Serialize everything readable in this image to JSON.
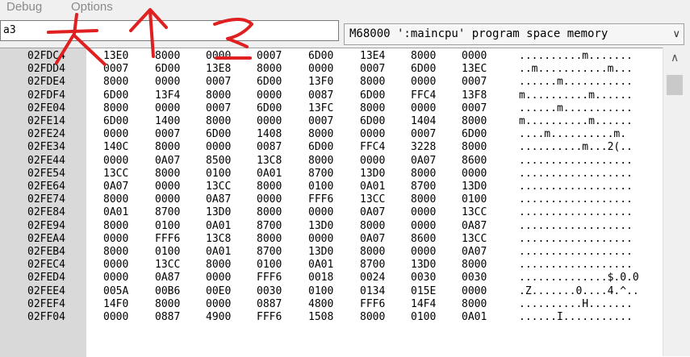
{
  "menu": {
    "debug": "Debug",
    "options": "Options"
  },
  "expression": {
    "value": "a3"
  },
  "space_selector": {
    "value": "M68000 ':maincpu' program space memory",
    "arrow": "∨"
  },
  "scrollbar": {
    "up_arrow": "∧"
  },
  "rows": [
    {
      "addr": "02FDC4",
      "w": [
        "13E0",
        "8000",
        "0000",
        "0007",
        "6D00",
        "13E4",
        "8000",
        "0000"
      ],
      "ascii": "..........m......."
    },
    {
      "addr": "02FDD4",
      "w": [
        "0007",
        "6D00",
        "13E8",
        "8000",
        "0000",
        "0007",
        "6D00",
        "13EC"
      ],
      "ascii": "..m...........m..."
    },
    {
      "addr": "02FDE4",
      "w": [
        "8000",
        "0000",
        "0007",
        "6D00",
        "13F0",
        "8000",
        "0000",
        "0007"
      ],
      "ascii": "......m..........."
    },
    {
      "addr": "02FDF4",
      "w": [
        "6D00",
        "13F4",
        "8000",
        "0000",
        "0087",
        "6D00",
        "FFC4",
        "13F8"
      ],
      "ascii": "m..........m......"
    },
    {
      "addr": "02FE04",
      "w": [
        "8000",
        "0000",
        "0007",
        "6D00",
        "13FC",
        "8000",
        "0000",
        "0007"
      ],
      "ascii": "......m..........."
    },
    {
      "addr": "02FE14",
      "w": [
        "6D00",
        "1400",
        "8000",
        "0000",
        "0007",
        "6D00",
        "1404",
        "8000"
      ],
      "ascii": "m..........m......"
    },
    {
      "addr": "02FE24",
      "w": [
        "0000",
        "0007",
        "6D00",
        "1408",
        "8000",
        "0000",
        "0007",
        "6D00"
      ],
      "ascii": "....m..........m."
    },
    {
      "addr": "02FE34",
      "w": [
        "140C",
        "8000",
        "0000",
        "0087",
        "6D00",
        "FFC4",
        "3228",
        "8000"
      ],
      "ascii": "..........m...2(.."
    },
    {
      "addr": "02FE44",
      "w": [
        "0000",
        "0A07",
        "8500",
        "13C8",
        "8000",
        "0000",
        "0A07",
        "8600"
      ],
      "ascii": ".................."
    },
    {
      "addr": "02FE54",
      "w": [
        "13CC",
        "8000",
        "0100",
        "0A01",
        "8700",
        "13D0",
        "8000",
        "0000"
      ],
      "ascii": ".................."
    },
    {
      "addr": "02FE64",
      "w": [
        "0A07",
        "0000",
        "13CC",
        "8000",
        "0100",
        "0A01",
        "8700",
        "13D0"
      ],
      "ascii": ".................."
    },
    {
      "addr": "02FE74",
      "w": [
        "8000",
        "0000",
        "0A87",
        "0000",
        "FFF6",
        "13CC",
        "8000",
        "0100"
      ],
      "ascii": ".................."
    },
    {
      "addr": "02FE84",
      "w": [
        "0A01",
        "8700",
        "13D0",
        "8000",
        "0000",
        "0A07",
        "0000",
        "13CC"
      ],
      "ascii": ".................."
    },
    {
      "addr": "02FE94",
      "w": [
        "8000",
        "0100",
        "0A01",
        "8700",
        "13D0",
        "8000",
        "0000",
        "0A87"
      ],
      "ascii": ".................."
    },
    {
      "addr": "02FEA4",
      "w": [
        "0000",
        "FFF6",
        "13C8",
        "8000",
        "0000",
        "0A07",
        "8600",
        "13CC"
      ],
      "ascii": ".................."
    },
    {
      "addr": "02FEB4",
      "w": [
        "8000",
        "0100",
        "0A01",
        "8700",
        "13D0",
        "8000",
        "0000",
        "0A07"
      ],
      "ascii": ".................."
    },
    {
      "addr": "02FEC4",
      "w": [
        "0000",
        "13CC",
        "8000",
        "0100",
        "0A01",
        "8700",
        "13D0",
        "8000"
      ],
      "ascii": ".................."
    },
    {
      "addr": "02FED4",
      "w": [
        "0000",
        "0A87",
        "0000",
        "FFF6",
        "0018",
        "0024",
        "0030",
        "0030"
      ],
      "ascii": "..............$.0.0"
    },
    {
      "addr": "02FEE4",
      "w": [
        "005A",
        "00B6",
        "00E0",
        "0030",
        "0100",
        "0134",
        "015E",
        "0000"
      ],
      "ascii": ".Z.......0....4.^.."
    },
    {
      "addr": "02FEF4",
      "w": [
        "14F0",
        "8000",
        "0000",
        "0887",
        "4800",
        "FFF6",
        "14F4",
        "8000"
      ],
      "ascii": "..........H......."
    },
    {
      "addr": "02FF04",
      "w": [
        "0000",
        "0887",
        "4900",
        "FFF6",
        "1508",
        "8000",
        "0100",
        "0A01"
      ],
      "ascii": "......I..........."
    }
  ]
}
